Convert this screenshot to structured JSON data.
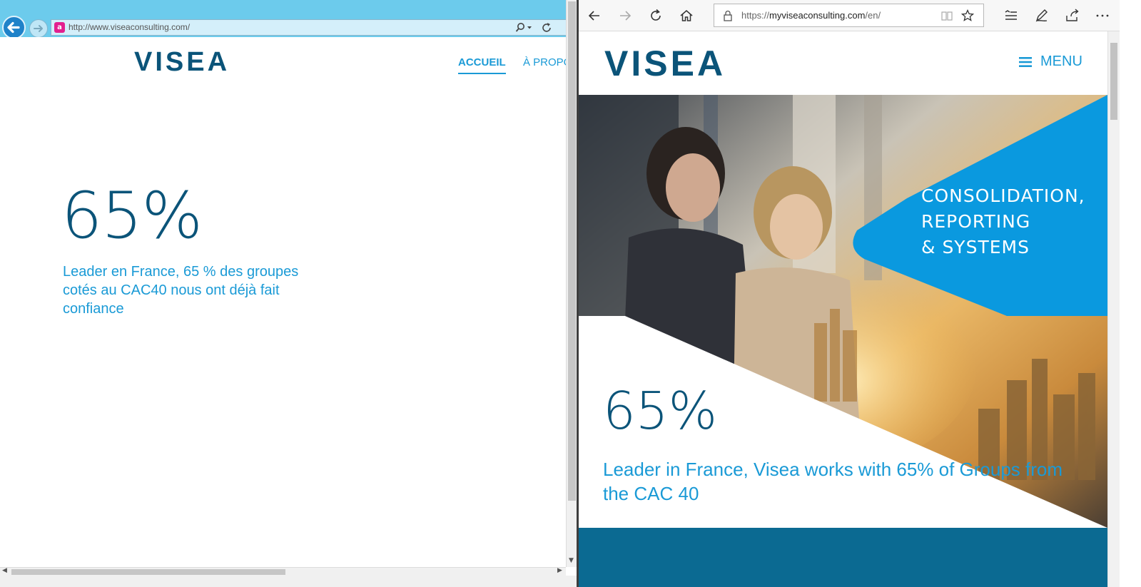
{
  "left_window": {
    "address_url": "http://www.viseaconsulting.com/",
    "favicon_letter": "a",
    "logo": "VISEA",
    "nav": {
      "accueil": "ACCUEIL",
      "apropos": "À PROPOS"
    },
    "stat_value": "65%",
    "stat_description": "Leader en France, 65 % des groupes cotés au CAC40 nous ont déjà fait confiance"
  },
  "right_window": {
    "address_scheme": "https://",
    "address_host": "myviseaconsulting.com",
    "address_path": "/en/",
    "logo": "VISEA",
    "menu_label": "MENU",
    "hero_title_lines": [
      "CONSOLIDATION,",
      "REPORTING",
      "& SYSTEMS"
    ],
    "stat_value": "65%",
    "stat_description": "Leader in France, Visea works with 65% of Groups from the CAC 40"
  },
  "colors": {
    "brand_dark": "#0b5479",
    "brand_accent": "#1a9ad6",
    "hero_blue": "#0a99df",
    "footer_band": "#0b6a92",
    "ie_chrome": "#6ccbec"
  }
}
